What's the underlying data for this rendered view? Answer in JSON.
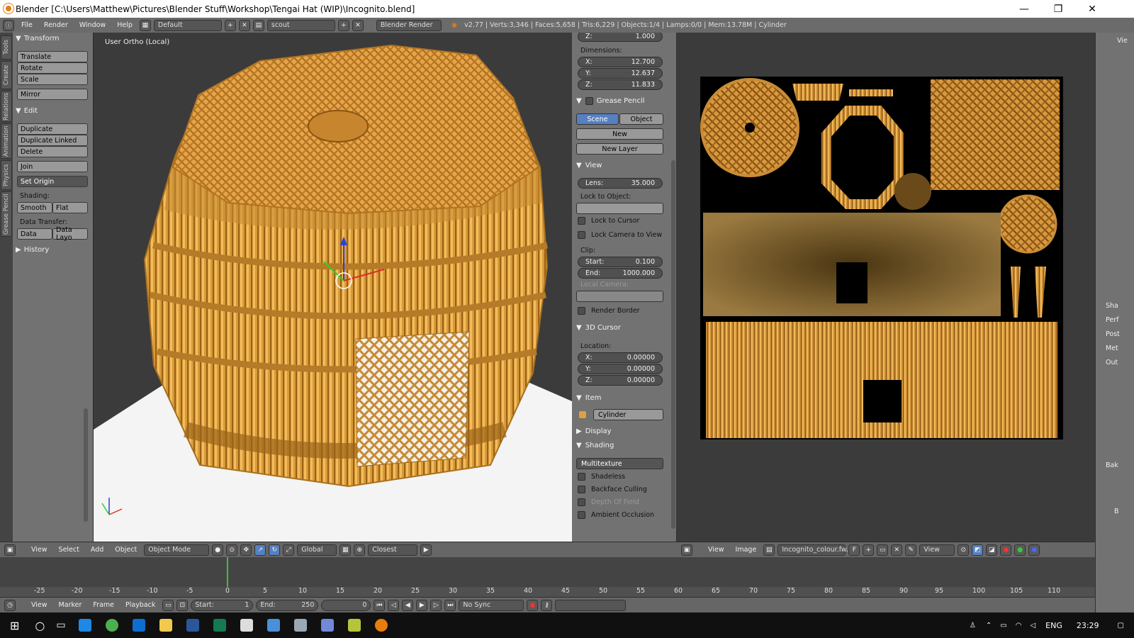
{
  "window": {
    "title": "Blender [C:\\Users\\Matthew\\Pictures\\Blender Stuff\\Workshop\\Tengai Hat (WIP)\\Incognito.blend]",
    "minimize": "—",
    "restore": "❐",
    "close": "✕"
  },
  "infobar": {
    "menus": [
      "File",
      "Render",
      "Window",
      "Help"
    ],
    "layout": "Default",
    "scene": "scout",
    "engine": "Blender Render",
    "stats": "v2.77 | Verts:3,346 | Faces:5,658 | Tris:6,229 | Objects:1/4 | Lamps:0/0 | Mem:13.78M | Cylinder"
  },
  "side_tabs": [
    "Tools",
    "Create",
    "Relations",
    "Animation",
    "Physics",
    "Grease Pencil"
  ],
  "tools": {
    "transform_header": "Transform",
    "translate": "Translate",
    "rotate": "Rotate",
    "scale": "Scale",
    "mirror": "Mirror",
    "edit_header": "Edit",
    "duplicate": "Duplicate",
    "duplicate_linked": "Duplicate Linked",
    "delete": "Delete",
    "join": "Join",
    "set_origin": "Set Origin",
    "shading_label": "Shading:",
    "smooth": "Smooth",
    "flat": "Flat",
    "data_transfer_label": "Data Transfer:",
    "data": "Data",
    "data_layo": "Data Layo",
    "history_header": "History"
  },
  "viewport": {
    "label": "User Ortho (Local)",
    "header": {
      "menus": [
        "View",
        "Select",
        "Add",
        "Object"
      ],
      "mode": "Object Mode",
      "orientation": "Global",
      "snap": "Closest"
    }
  },
  "properties": {
    "scale_z_label": "Z:",
    "scale_z": "1.000",
    "dimensions_label": "Dimensions:",
    "dim": [
      {
        "axis": "X:",
        "value": "12.700"
      },
      {
        "axis": "Y:",
        "value": "12.637"
      },
      {
        "axis": "Z:",
        "value": "11.833"
      }
    ],
    "grease_pencil": "Grease Pencil",
    "scene_btn": "Scene",
    "object_btn": "Object",
    "new_btn": "New",
    "new_layer": "New Layer",
    "view_header": "View",
    "lens_label": "Lens:",
    "lens": "35.000",
    "lock_to_object": "Lock to Object:",
    "lock_to_cursor": "Lock to Cursor",
    "lock_camera": "Lock Camera to View",
    "clip_label": "Clip:",
    "start_label": "Start:",
    "start": "0.100",
    "end_label": "End:",
    "end": "1000.000",
    "local_camera": "Local Camera:",
    "render_border": "Render Border",
    "cursor_header": "3D Cursor",
    "location_label": "Location:",
    "loc": [
      {
        "axis": "X:",
        "value": "0.00000"
      },
      {
        "axis": "Y:",
        "value": "0.00000"
      },
      {
        "axis": "Z:",
        "value": "0.00000"
      }
    ],
    "item_header": "Item",
    "item_name": "Cylinder",
    "display_header": "Display",
    "shading_header": "Shading",
    "shading_mode": "Multitexture",
    "shadeless": "Shadeless",
    "backface": "Backface Culling",
    "dof": "Depth Of Field",
    "ao": "Ambient Occlusion"
  },
  "uv": {
    "header": {
      "menus": [
        "View",
        "Image"
      ],
      "image_name": "Incognito_colour.fw....",
      "f": "F",
      "view": "View"
    }
  },
  "far_right": {
    "labels": [
      "Vie",
      "Sha",
      "Perf",
      "Post",
      "Met",
      "Out",
      "Bak",
      "B"
    ]
  },
  "timeline": {
    "ruler": [
      "-25",
      "-20",
      "-15",
      "-10",
      "-5",
      "0",
      "5",
      "10",
      "15",
      "20",
      "25",
      "30",
      "35",
      "40",
      "45",
      "50",
      "55",
      "60",
      "65",
      "70",
      "75",
      "80",
      "85",
      "90",
      "95",
      "100",
      "105",
      "110"
    ],
    "menus": [
      "View",
      "Marker",
      "Frame",
      "Playback"
    ],
    "start_label": "Start:",
    "start": "1",
    "end_label": "End:",
    "end": "250",
    "current": "0",
    "sync": "No Sync"
  },
  "taskbar": {
    "lang": "ENG",
    "time": "23:29"
  },
  "colors": {
    "accent": "#e87d0d",
    "selected": "#5680c2"
  }
}
